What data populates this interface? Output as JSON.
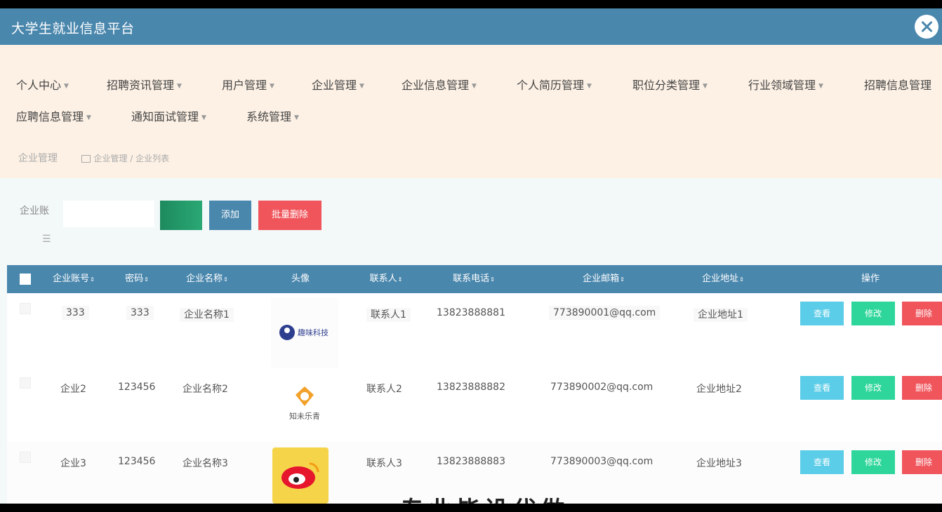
{
  "app": {
    "title": "大学生就业信息平台"
  },
  "nav": {
    "items": [
      "个人中心",
      "招聘资讯管理",
      "用户管理",
      "企业管理",
      "企业信息管理",
      "个人简历管理",
      "职位分类管理",
      "行业领域管理",
      "招聘信息管理",
      "应聘信息管理",
      "通知面试管理",
      "系统管理"
    ]
  },
  "breadcrumb": {
    "root": "企业管理",
    "path": "企业管理 / 企业列表"
  },
  "search": {
    "label": "企业账",
    "value": "",
    "placeholder": ""
  },
  "buttons": {
    "search": "",
    "add": "添加",
    "batch_delete": "批量删除"
  },
  "table": {
    "headers": [
      "企业账号",
      "密码",
      "企业名称",
      "头像",
      "联系人",
      "联系电话",
      "企业邮箱",
      "企业地址",
      "操作"
    ],
    "rows": [
      {
        "account": "333",
        "password": "333",
        "name": "企业名称1",
        "contact": "联系人1",
        "phone": "13823888881",
        "email": "773890001@qq.com",
        "address": "企业地址1"
      },
      {
        "account": "企业2",
        "password": "123456",
        "name": "企业名称2",
        "contact": "联系人2",
        "phone": "13823888882",
        "email": "773890002@qq.com",
        "address": "企业地址2"
      },
      {
        "account": "企业3",
        "password": "123456",
        "name": "企业名称3",
        "contact": "联系人3",
        "phone": "13823888883",
        "email": "773890003@qq.com",
        "address": "企业地址3"
      }
    ],
    "actions": {
      "view": "查看",
      "edit": "修改",
      "delete": "删除"
    }
  },
  "logos": {
    "row1_text": "趣味科技",
    "row2_text": "知未乐青"
  },
  "watermark": "专业毕设代做",
  "colors": {
    "primary": "#4a87ad",
    "nav_bg": "#fdf1e5",
    "danger": "#f0555c",
    "success": "#2ed69b",
    "info": "#5ccde8"
  },
  "icons": {
    "close": "close-icon",
    "home": "home-icon",
    "sort": "sort-icon",
    "menu": "menu-icon"
  }
}
